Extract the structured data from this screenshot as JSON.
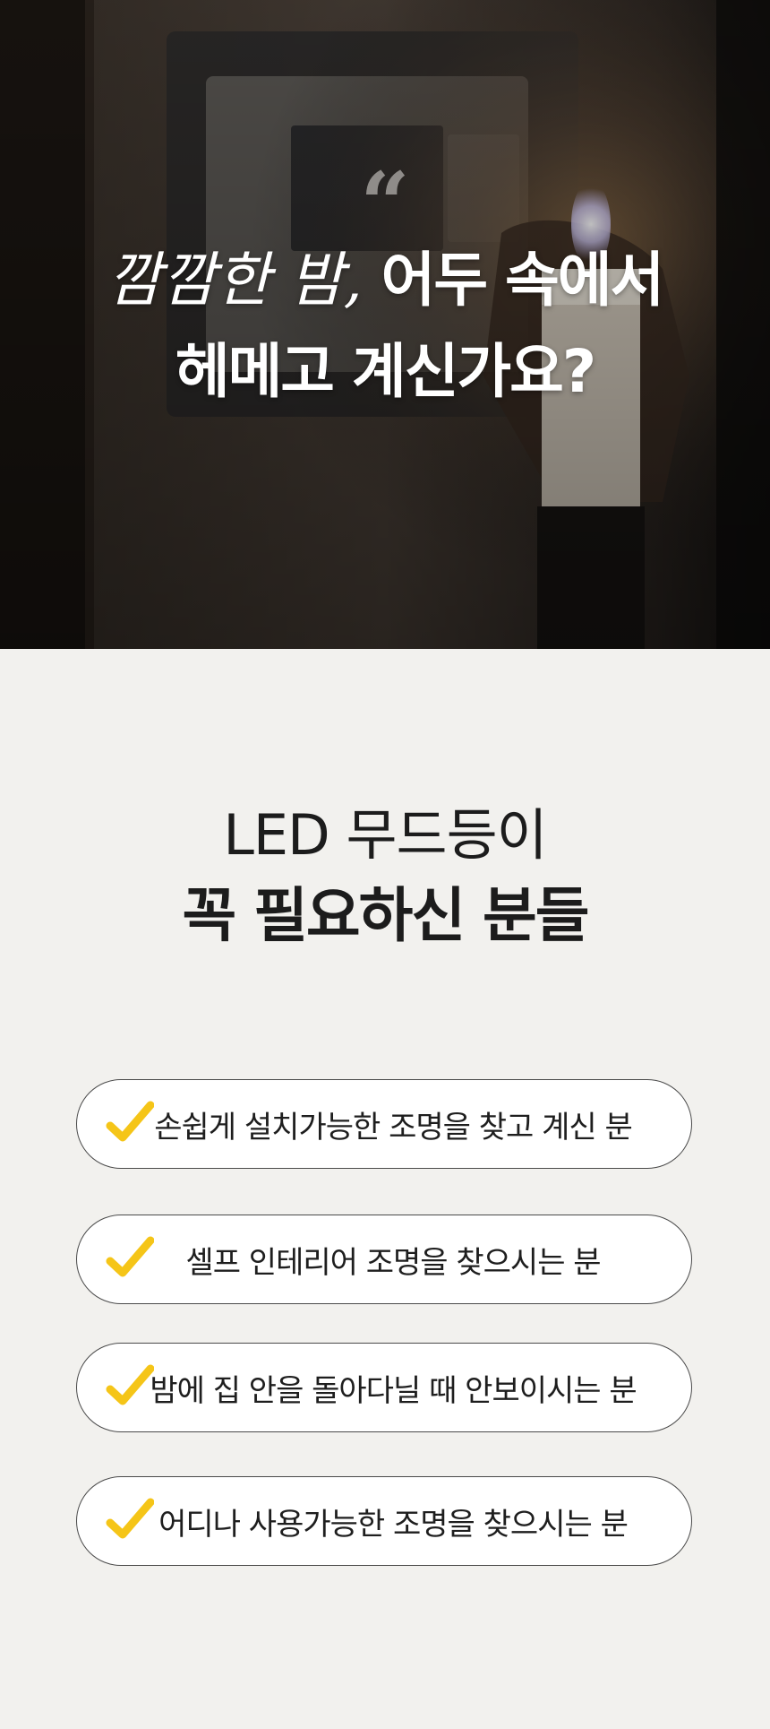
{
  "hero": {
    "quote_mark": "“",
    "title_script": "깜깜한 밤,",
    "title_bold_line1": "어두 속에서",
    "title_line2": "헤메고 계신가요?"
  },
  "section": {
    "heading_line1": "LED 무드등이",
    "heading_line2": "꼭 필요하신 분들"
  },
  "checklist": [
    {
      "icon": "check-icon",
      "text": "손쉽게 설치가능한 조명을 찾고 계신 분"
    },
    {
      "icon": "check-icon",
      "text": "셀프 인테리어 조명을 찾으시는 분"
    },
    {
      "icon": "check-icon",
      "text": "밤에 집 안을 돌아다닐 때 안보이시는 분"
    },
    {
      "icon": "check-icon",
      "text": "어디나 사용가능한 조명을 찾으시는 분"
    }
  ],
  "colors": {
    "check": "#f5c518",
    "background": "#f2f1ee",
    "text": "#1c1c1c"
  }
}
